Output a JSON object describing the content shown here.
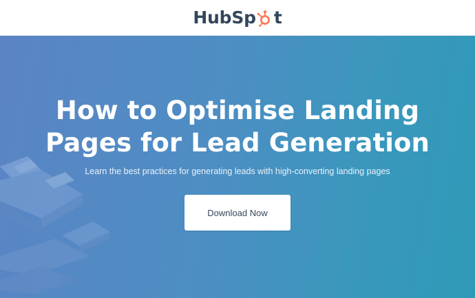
{
  "header": {
    "logo": {
      "text_before": "HubSp",
      "text_after": "t",
      "icon": "hubspot-sprocket-icon",
      "accent_color": "#ff7a59",
      "text_color": "#33475b"
    }
  },
  "hero": {
    "title_line_1": "How to Optimise Landing",
    "title_line_2": "Pages for Lead Generation",
    "subtitle": "Learn the best practices for generating leads with high-converting landing pages",
    "cta_label": "Download Now",
    "background_colors": [
      "#5b84c4",
      "#2f9ab8"
    ],
    "illustration": "isometric-landing-page-illustration"
  }
}
